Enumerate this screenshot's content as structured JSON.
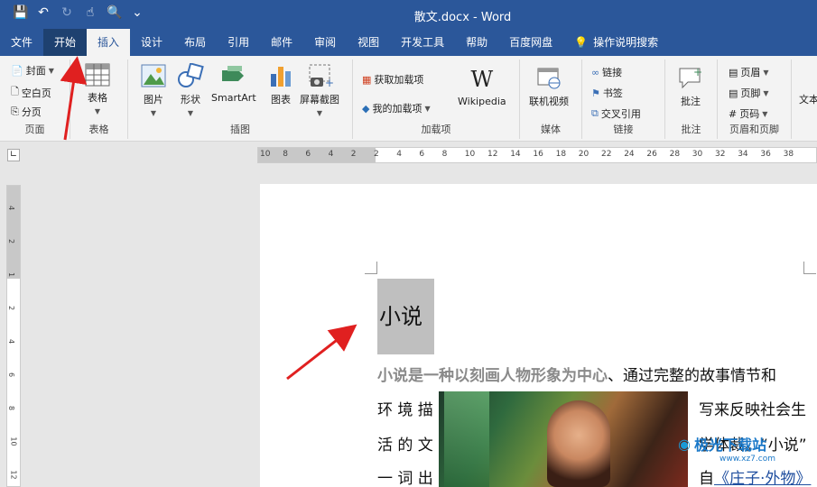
{
  "window": {
    "title": "散文.docx  -  Word"
  },
  "qat": {
    "save_icon": "💾",
    "undo_icon": "↶",
    "redo_icon": "↻",
    "touch_icon": "☝",
    "preview_icon": "🔍",
    "more_icon": "⌄"
  },
  "tabs": [
    "文件",
    "开始",
    "插入",
    "设计",
    "布局",
    "引用",
    "邮件",
    "审阅",
    "视图",
    "开发工具",
    "帮助",
    "百度网盘"
  ],
  "search_label": "操作说明搜索",
  "ribbon": {
    "pages": {
      "cover": "封面",
      "blank": "空白页",
      "break": "分页",
      "label": "页面"
    },
    "tables": {
      "table": "表格",
      "label": "表格"
    },
    "illustrations": {
      "picture": "图片",
      "shapes": "形状",
      "smartart": "SmartArt",
      "chart": "图表",
      "screenshot": "屏幕截图",
      "label": "插图"
    },
    "addins": {
      "get": "获取加载项",
      "mine": "我的加载项",
      "wikipedia": "Wikipedia",
      "label": "加载项"
    },
    "media": {
      "video": "联机视频",
      "label": "媒体"
    },
    "links": {
      "link": "链接",
      "bookmark": "书签",
      "cross_ref": "交叉引用",
      "label": "链接"
    },
    "comments": {
      "comment": "批注",
      "label": "批注"
    },
    "header_footer": {
      "header": "页眉",
      "footer": "页脚",
      "page_number": "页码",
      "label": "页眉和页脚"
    },
    "text": {
      "label": "文本"
    }
  },
  "ruler_numbers": [
    "10",
    "8",
    "6",
    "4",
    "2",
    "2",
    "4",
    "6",
    "8",
    "10",
    "12",
    "14",
    "16",
    "18",
    "20",
    "22",
    "24",
    "26",
    "28",
    "30",
    "32",
    "34",
    "36",
    "38"
  ],
  "vruler_numbers": [
    "4",
    "2",
    "1",
    "2",
    "4",
    "6",
    "8",
    "10",
    "12"
  ],
  "document": {
    "heading": "小说",
    "para1_grey": "小说是一种以刻画人物形象为中心",
    "para1_rest": "、通过完整的故事情节和",
    "line2_left": "环 境 描",
    "line2_right": "写来反映社会生",
    "line3_left": "活 的 文",
    "line3_right": "学体裁。“小说”",
    "line4_left": "一 词 出",
    "line4_right_a": "自",
    "line4_link": "《庄子·外物》",
    "watermark": "极光下载站",
    "watermark_sub": "www.xz7.com"
  }
}
